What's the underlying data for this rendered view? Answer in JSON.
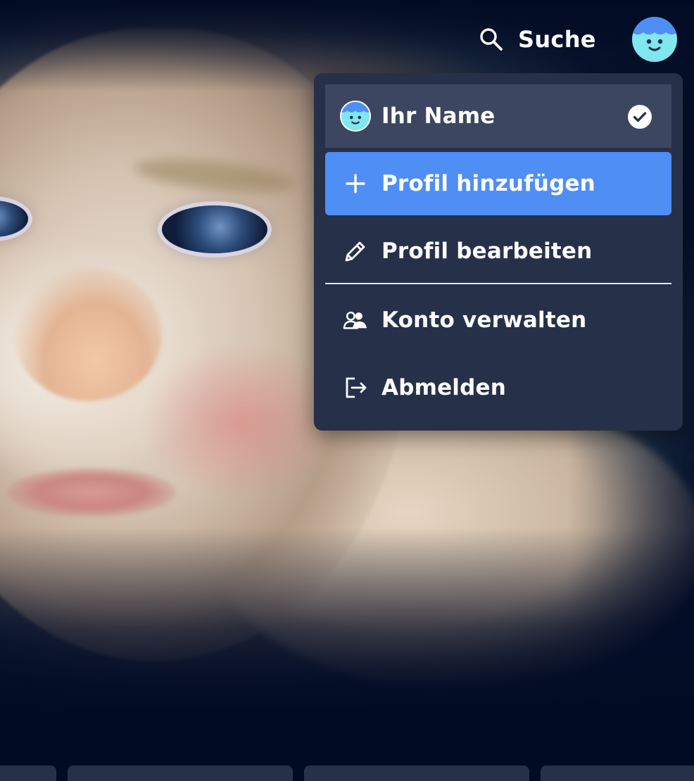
{
  "header": {
    "search_label": "Suche",
    "search_icon": "search-icon",
    "avatar_icon": "kid-avatar-icon"
  },
  "menu": {
    "profile": {
      "name": "Ihr Name",
      "avatar_icon": "kid-avatar-icon",
      "status_icon": "check-circle-icon",
      "selected": true
    },
    "items": [
      {
        "label": "Profil hinzufügen",
        "icon": "plus-icon",
        "highlighted": true
      },
      {
        "label": "Profil bearbeiten",
        "icon": "pencil-icon",
        "highlighted": false
      },
      {
        "label": "Konto verwalten",
        "icon": "users-icon",
        "highlighted": false
      },
      {
        "label": "Abmelden",
        "icon": "logout-icon",
        "highlighted": false
      }
    ]
  },
  "colors": {
    "background": "#020b24",
    "menu_background": "#263149",
    "selected_row": "#3c4660",
    "accent": "#4f8ef5",
    "avatar": "#7fe8ee",
    "avatar_hair": "#4f8ef5",
    "text": "#ffffff"
  }
}
